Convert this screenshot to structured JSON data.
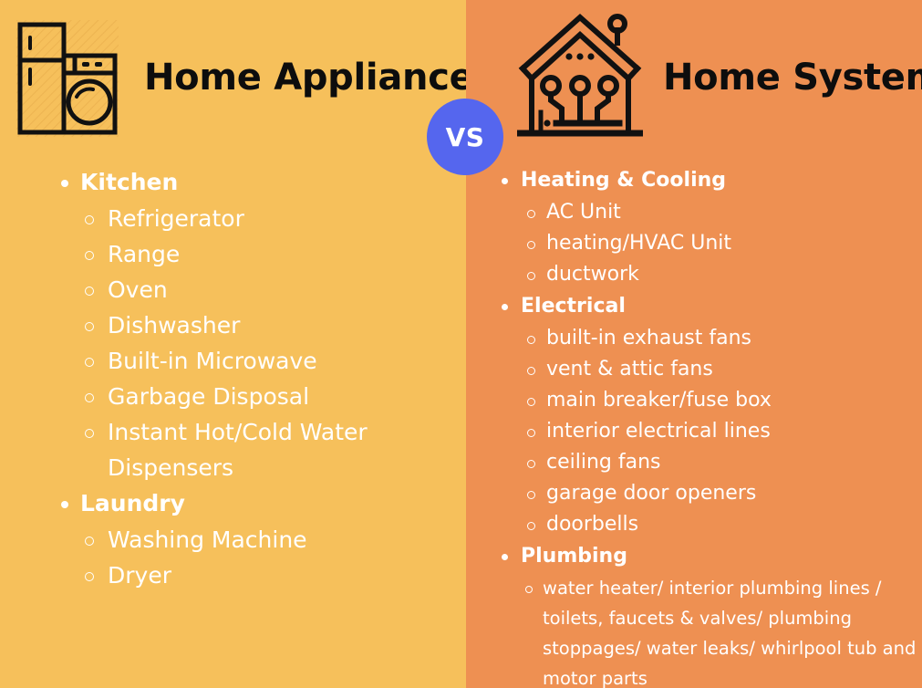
{
  "theme": {
    "left_bg": "#F6C05B",
    "right_bg": "#EE9052",
    "badge_bg": "#5566EE",
    "title_color": "#0D0D0D",
    "list_color": "#FFFFFF"
  },
  "badge": {
    "label": "VS"
  },
  "left": {
    "title": "Home Appliances",
    "icon": "refrigerator-washing-machine-icon",
    "groups": [
      {
        "label": "Kitchen",
        "items": [
          "Refrigerator",
          "Range",
          "Oven",
          "Dishwasher",
          "Built-in Microwave",
          "Garbage Disposal",
          "Instant Hot/Cold Water Dispensers"
        ]
      },
      {
        "label": "Laundry",
        "items": [
          "Washing Machine",
          "Dryer"
        ]
      }
    ]
  },
  "right": {
    "title": "Home Systems",
    "icon": "smart-home-circuit-icon",
    "groups": [
      {
        "label": "Heating & Cooling",
        "items": [
          "AC Unit",
          "heating/HVAC Unit",
          "ductwork"
        ]
      },
      {
        "label": "Electrical",
        "items": [
          "built-in exhaust fans",
          "vent & attic fans",
          "main breaker/fuse box",
          "interior electrical lines",
          "ceiling fans",
          "garage door openers",
          "doorbells"
        ]
      },
      {
        "label": "Plumbing",
        "items": [
          "water heater/ interior plumbing lines / toilets, faucets & valves/ plumbing stoppages/ water leaks/ whirlpool tub and motor parts"
        ]
      }
    ]
  }
}
